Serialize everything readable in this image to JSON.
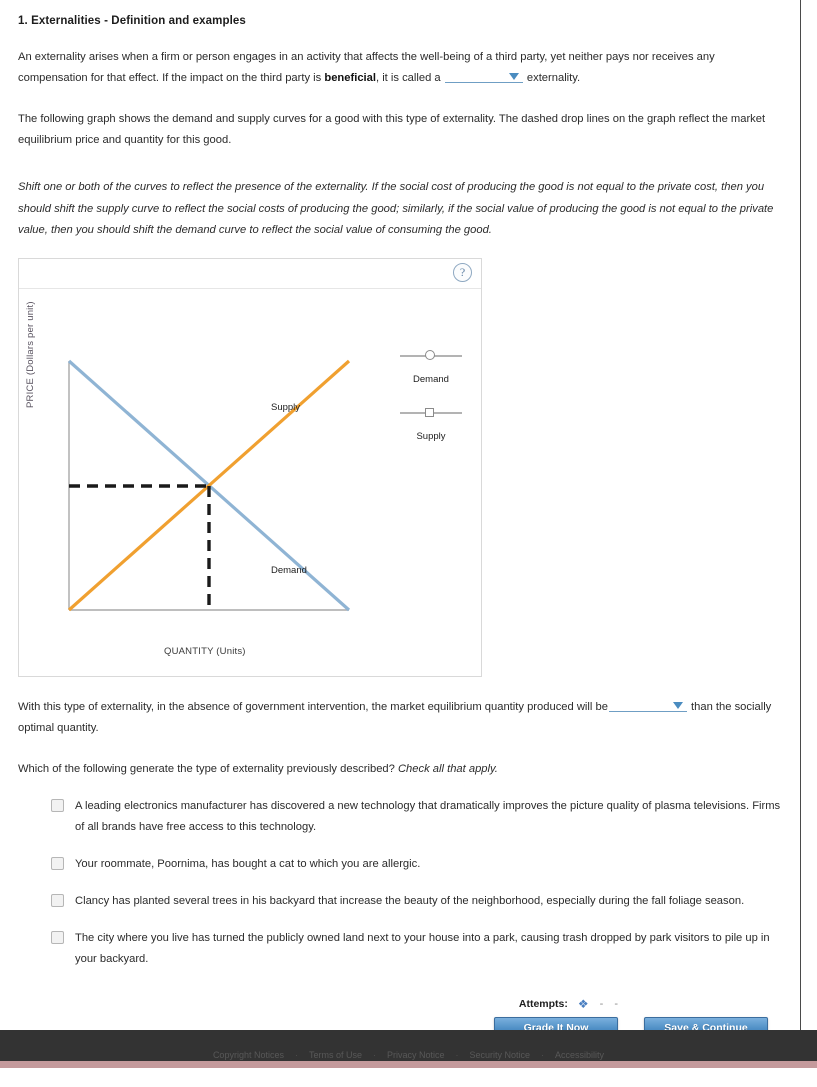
{
  "question": {
    "number_title": "1. Externalities - Definition and examples",
    "paragraph1_part1": "An externality arises when a firm or person engages in an activity that affects the well-being of a third party, yet neither pays nor receives any compensation for that effect. If the impact on the third party is ",
    "paragraph1_bold": "beneficial",
    "paragraph1_part2": ", it is called a ",
    "paragraph1_part3": " externality.",
    "paragraph2": "The following graph shows the demand and supply curves for a good with this type of externality. The dashed drop lines on the graph reflect the market equilibrium price and quantity for this good.",
    "instruction_italic": "Shift one or both of the curves to reflect the presence of the externality. If the social cost of producing the good is not equal to the private cost, then you should shift the supply curve to reflect the social costs of producing the good; similarly, if the social value of producing the good is not equal to the private value, then you should shift the demand curve to reflect the social value of consuming the good.",
    "paragraph3_part1": "With this type of externality, in the absence of government intervention, the market equilibrium quantity produced will be",
    "paragraph3_part2": " than the socially optimal quantity.",
    "checklist_prompt_plain": "Which of the following generate the type of externality previously described? ",
    "checklist_prompt_italic": "Check all that apply."
  },
  "dropdowns": {
    "externality_type": {
      "value": "",
      "icon": "chevron-down-icon"
    },
    "quantity_comparison": {
      "value": "",
      "icon": "chevron-down-icon"
    }
  },
  "graph": {
    "help_icon": "question-mark-icon",
    "x_axis_label": "QUANTITY (Units)",
    "y_axis_label": "PRICE (Dollars per unit)",
    "curve_labels": {
      "supply": "Supply",
      "demand": "Demand"
    },
    "legend": [
      {
        "label": "Demand",
        "marker": "circle-marker",
        "line_color": "#b3b3b3"
      },
      {
        "label": "Supply",
        "marker": "square-marker",
        "line_color": "#b3b3b3"
      }
    ]
  },
  "chart_data": {
    "type": "line",
    "title": "",
    "xlabel": "QUANTITY (Units)",
    "ylabel": "PRICE (Dollars per unit)",
    "xlim": [
      0,
      100
    ],
    "ylim": [
      0,
      100
    ],
    "grid": false,
    "legend_position": "right",
    "series": [
      {
        "name": "Demand",
        "color": "#8fb4d4",
        "marker": "circle",
        "x": [
          0,
          100
        ],
        "y": [
          100,
          0
        ]
      },
      {
        "name": "Supply",
        "color": "#f0a030",
        "marker": "square",
        "x": [
          0,
          100
        ],
        "y": [
          0,
          100
        ]
      }
    ],
    "equilibrium": {
      "x": 50,
      "y": 50,
      "droplines": "dashed-black"
    },
    "annotations": [
      {
        "text": "Supply",
        "x": 62,
        "y": 72
      },
      {
        "text": "Demand",
        "x": 62,
        "y": 27
      }
    ]
  },
  "choices": [
    {
      "id": "choice-1",
      "checked": false,
      "label": "A leading electronics manufacturer has discovered a new technology that dramatically improves the picture quality of plasma televisions. Firms of all brands have free access to this technology."
    },
    {
      "id": "choice-2",
      "checked": false,
      "label": "Your roommate, Poornima, has bought a cat to which you are allergic."
    },
    {
      "id": "choice-3",
      "checked": false,
      "label": "Clancy has planted several trees in his backyard that increase the beauty of the neighborhood, especially during the fall foliage season."
    },
    {
      "id": "choice-4",
      "checked": false,
      "label": "The city where you live has turned the publicly owned land next to your house into a park, causing trash dropped by park visitors to pile up in your backyard."
    }
  ],
  "actions": {
    "attempts_label": "Attempts:",
    "attempts_icon": "diamond-marker-icon",
    "attempts_dash_1": "-",
    "attempts_dash_2": "-",
    "grade_button": "Grade It Now",
    "save_button": "Save & Continue"
  },
  "footer": {
    "links": [
      "Copyright Notices",
      "Terms of Use",
      "Privacy Notice",
      "Security Notice",
      "Accessibility"
    ],
    "separator": "·",
    "background_color": "#333333",
    "band_color": "#c49a9c"
  }
}
